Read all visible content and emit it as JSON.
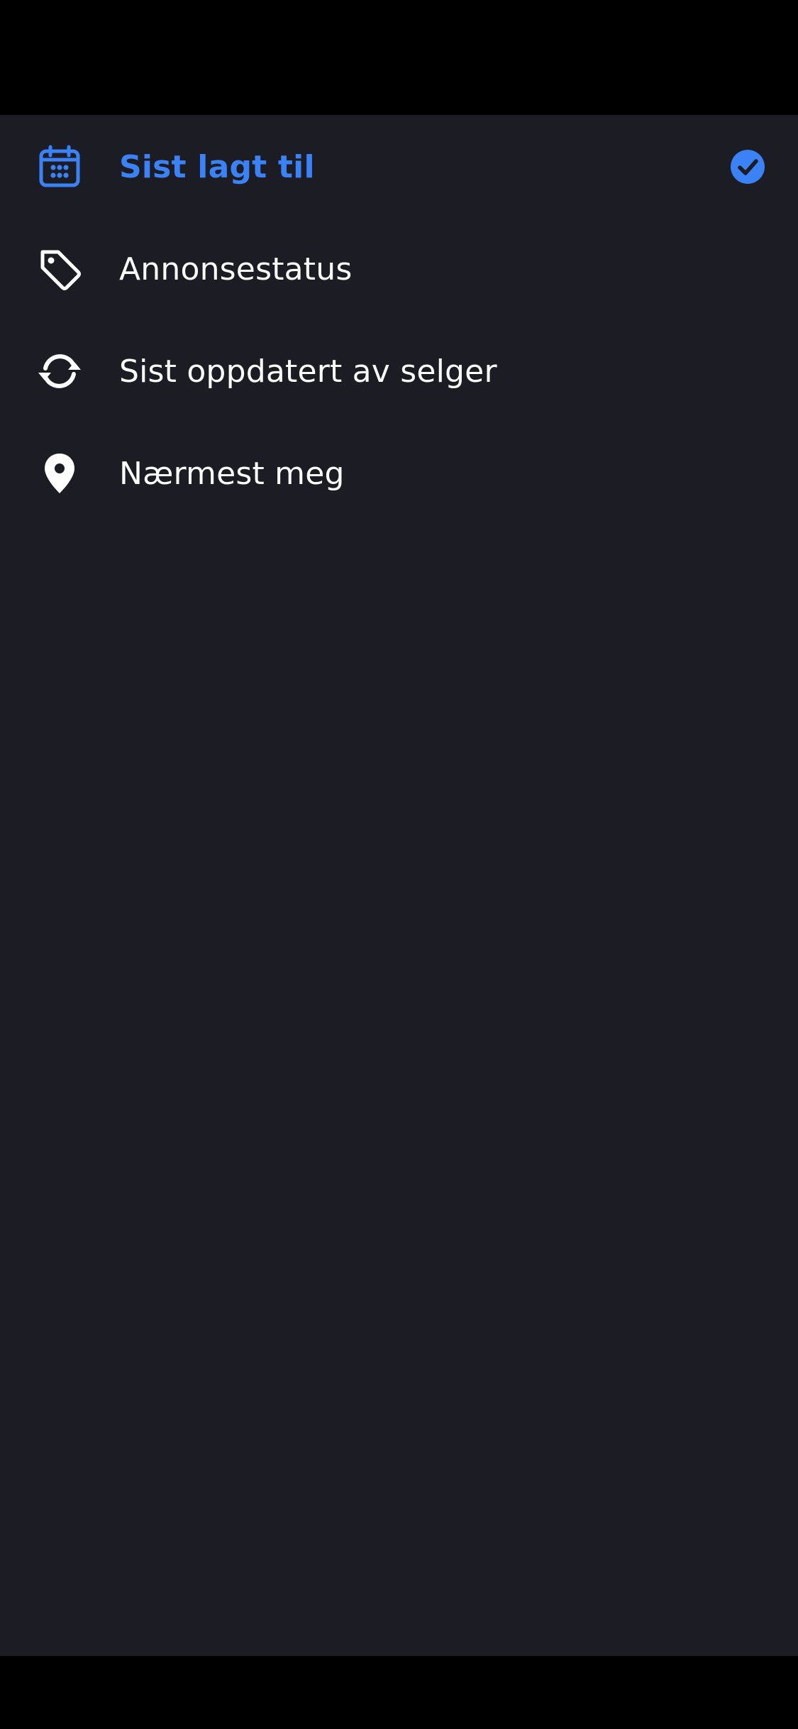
{
  "colors": {
    "sheet_background": "#1c1c24",
    "accent": "#3b82f6",
    "text": "#ffffff"
  },
  "sort_options": [
    {
      "label": "Sist lagt til",
      "icon": "calendar-icon",
      "selected": true
    },
    {
      "label": "Annonsestatus",
      "icon": "tag-icon",
      "selected": false
    },
    {
      "label": "Sist oppdatert av selger",
      "icon": "refresh-icon",
      "selected": false
    },
    {
      "label": "Nærmest meg",
      "icon": "location-pin-icon",
      "selected": false
    }
  ],
  "selected_indicator": "checkmark-circle-icon"
}
